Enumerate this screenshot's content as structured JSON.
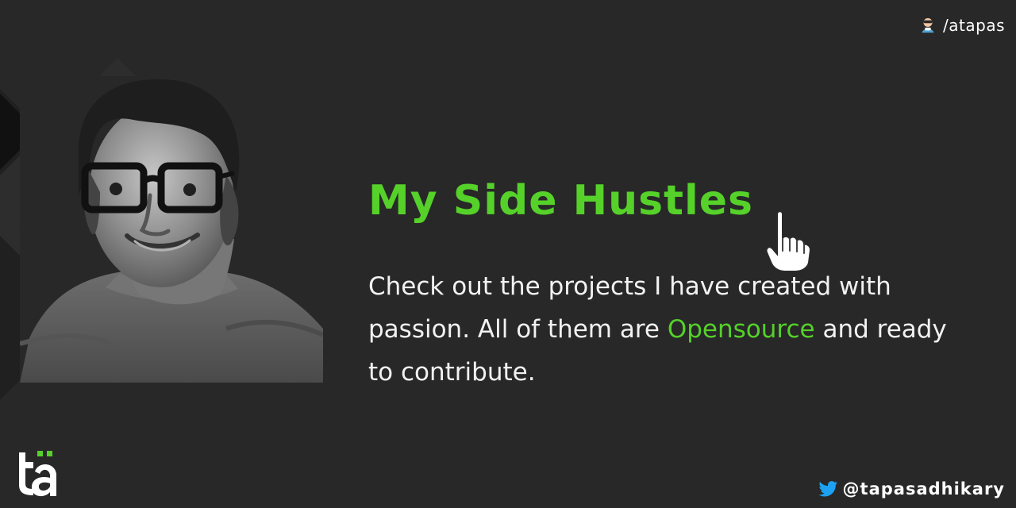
{
  "profile": {
    "top_handle": "/atapas",
    "twitter_handle": "@tapasadhikary"
  },
  "main": {
    "title": "My Side Hustles",
    "description_before": "Check out the projects I have created with passion. All of them are ",
    "description_highlight": "Opensource",
    "description_after": " and ready to contribute."
  },
  "colors": {
    "background": "#282828",
    "accent": "#55d12a",
    "text": "#f2f2f2",
    "twitter": "#1da1f2"
  },
  "icons": {
    "top_handle": "mini-avatar-icon",
    "pointer": "pointing-hand-icon",
    "brand": "ta-logo-icon",
    "twitter": "twitter-icon"
  }
}
